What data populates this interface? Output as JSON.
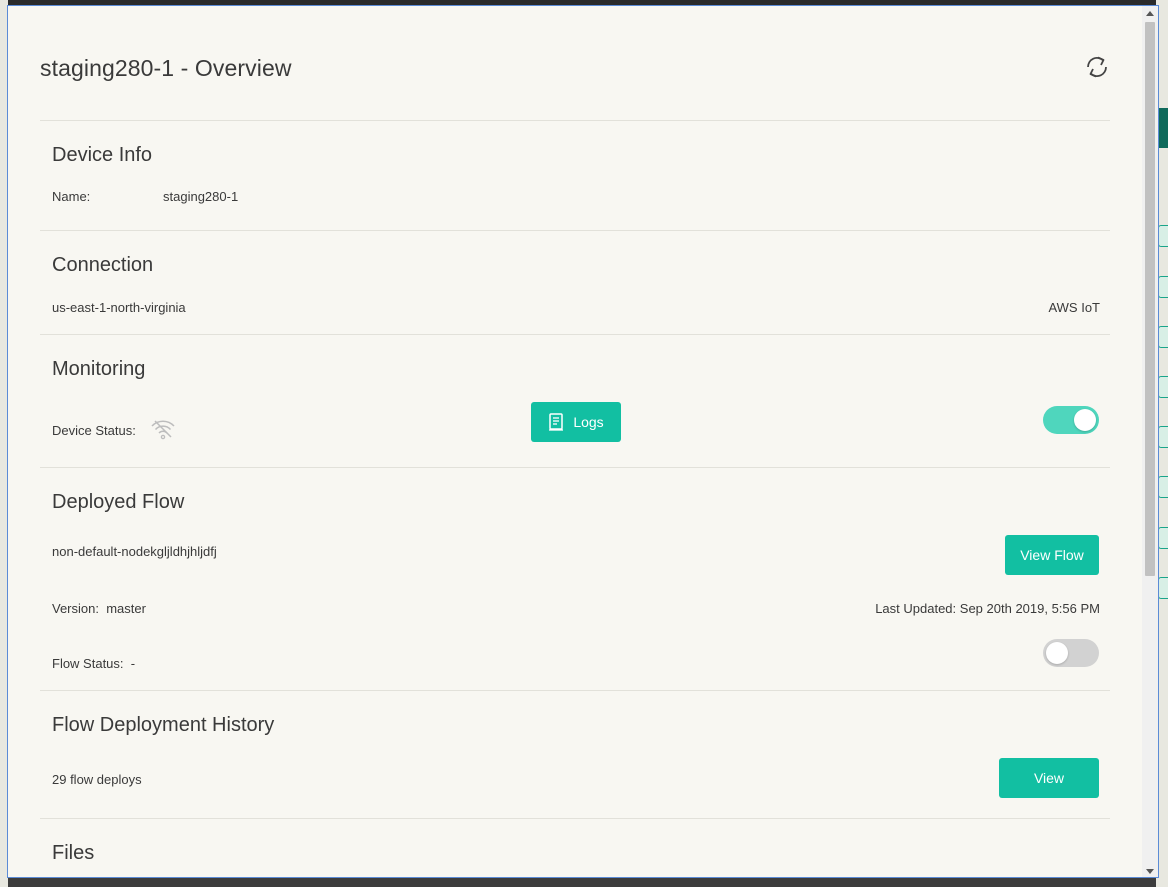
{
  "header": {
    "title": "staging280-1 - Overview"
  },
  "device_info": {
    "title": "Device Info",
    "name_label": "Name:",
    "name_value": "staging280-1"
  },
  "connection": {
    "title": "Connection",
    "region": "us-east-1-north-virginia",
    "provider": "AWS IoT"
  },
  "monitoring": {
    "title": "Monitoring",
    "status_label": "Device Status:",
    "status_icon": "wifi-off-icon",
    "logs_label": "Logs",
    "toggle_on": true
  },
  "deployed_flow": {
    "title": "Deployed Flow",
    "flow_name": "non-default-nodekgljldhjhljdfj",
    "view_flow_label": "View Flow",
    "version_label": "Version:",
    "version_value": "master",
    "last_updated_label": "Last Updated:",
    "last_updated_value": "Sep 20th 2019, 5:56 PM",
    "flow_status_label": "Flow Status:",
    "flow_status_value": "-",
    "toggle_on": false
  },
  "flow_history": {
    "title": "Flow Deployment History",
    "summary": "29 flow deploys",
    "view_label": "View"
  },
  "files": {
    "title": "Files"
  },
  "colors": {
    "accent": "#12bfa2",
    "toggle_on": "#4fd6bd",
    "toggle_off": "#d2d2d2",
    "background": "#f8f7f2"
  }
}
